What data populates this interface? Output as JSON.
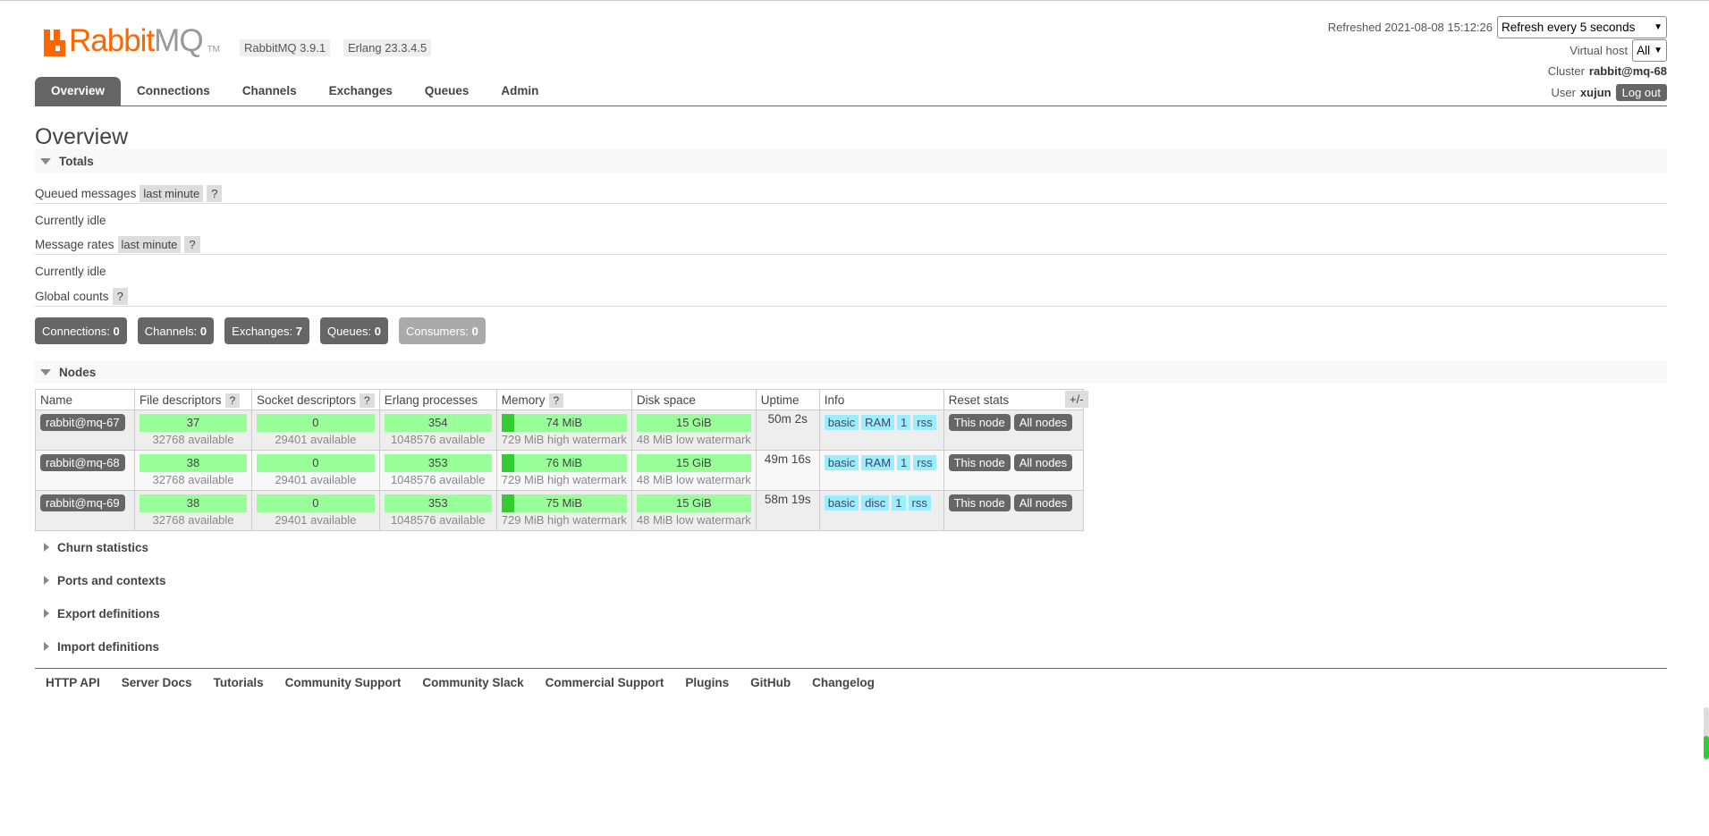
{
  "header": {
    "logo_r": "Rabbit",
    "logo_m": "MQ",
    "logo_tm": "TM",
    "version": "RabbitMQ 3.9.1",
    "erlang": "Erlang 23.3.4.5",
    "refreshed_label": "Refreshed 2021-08-08 15:12:26",
    "refresh_select": "Refresh every 5 seconds",
    "vhost_label": "Virtual host",
    "vhost_select": "All",
    "cluster_label": "Cluster",
    "cluster_value": "rabbit@mq-68",
    "user_label": "User",
    "user_value": "xujun",
    "logout_label": "Log out"
  },
  "tabs": [
    "Overview",
    "Connections",
    "Channels",
    "Exchanges",
    "Queues",
    "Admin"
  ],
  "page_title": "Overview",
  "totals": {
    "header": "Totals",
    "queued_label": "Queued messages",
    "queued_chip": "last minute",
    "qmark": "?",
    "idle1": "Currently idle",
    "rates_label": "Message rates",
    "rates_chip": "last minute",
    "idle2": "Currently idle",
    "global_label": "Global counts"
  },
  "counts": [
    {
      "label": "Connections:",
      "value": "0"
    },
    {
      "label": "Channels:",
      "value": "0"
    },
    {
      "label": "Exchanges:",
      "value": "7"
    },
    {
      "label": "Queues:",
      "value": "0"
    },
    {
      "label": "Consumers:",
      "value": "0"
    }
  ],
  "nodes": {
    "header": "Nodes",
    "columns": [
      "Name",
      "File descriptors",
      "Socket descriptors",
      "Erlang processes",
      "Memory",
      "Disk space",
      "Uptime",
      "Info",
      "Reset stats"
    ],
    "plusminus": "+/-",
    "rows": [
      {
        "name": "rabbit@mq-67",
        "fd": "37",
        "fd_avail": "32768 available",
        "sd": "0",
        "sd_avail": "29401 available",
        "ep": "354",
        "ep_avail": "1048576 available",
        "mem": "74 MiB",
        "mem_fraction": 0.1,
        "mem_sub": "729 MiB high watermark",
        "disk": "15 GiB",
        "disk_sub": "48 MiB low watermark",
        "uptime": "50m 2s",
        "info": [
          "basic",
          "RAM",
          "1",
          "rss"
        ],
        "btn1": "This node",
        "btn2": "All nodes"
      },
      {
        "name": "rabbit@mq-68",
        "fd": "38",
        "fd_avail": "32768 available",
        "sd": "0",
        "sd_avail": "29401 available",
        "ep": "353",
        "ep_avail": "1048576 available",
        "mem": "76 MiB",
        "mem_fraction": 0.1,
        "mem_sub": "729 MiB high watermark",
        "disk": "15 GiB",
        "disk_sub": "48 MiB low watermark",
        "uptime": "49m 16s",
        "info": [
          "basic",
          "RAM",
          "1",
          "rss"
        ],
        "btn1": "This node",
        "btn2": "All nodes"
      },
      {
        "name": "rabbit@mq-69",
        "fd": "38",
        "fd_avail": "32768 available",
        "sd": "0",
        "sd_avail": "29401 available",
        "ep": "353",
        "ep_avail": "1048576 available",
        "mem": "75 MiB",
        "mem_fraction": 0.1,
        "mem_sub": "729 MiB high watermark",
        "disk": "15 GiB",
        "disk_sub": "48 MiB low watermark",
        "uptime": "58m 19s",
        "info": [
          "basic",
          "disc",
          "1",
          "rss"
        ],
        "btn1": "This node",
        "btn2": "All nodes"
      }
    ]
  },
  "collapsed_sections": [
    "Churn statistics",
    "Ports and contexts",
    "Export definitions",
    "Import definitions"
  ],
  "footer_links": [
    "HTTP API",
    "Server Docs",
    "Tutorials",
    "Community Support",
    "Community Slack",
    "Commercial Support",
    "Plugins",
    "GitHub",
    "Changelog"
  ],
  "colors": {
    "brand": "#ff6600",
    "bar_green": "#99ff99",
    "tag_blue": "#99eeff",
    "button_grey": "#666666"
  }
}
